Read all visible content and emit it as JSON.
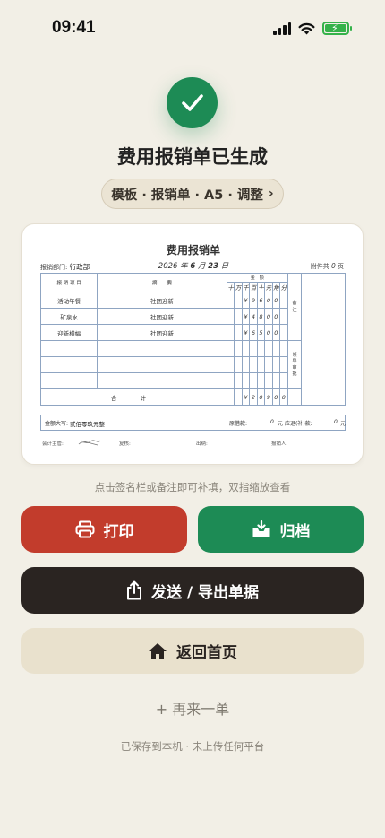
{
  "status_bar": {
    "time": "09:41"
  },
  "success": {
    "title": "费用报销单已生成"
  },
  "template_pill": {
    "label": "模板 · 报销单 · A5 · 调整",
    "chevron": "›"
  },
  "document": {
    "title": "费用报销单",
    "department_label": "报销部门:",
    "department": "行政部",
    "date_year": "2026",
    "date_month": "6",
    "date_day": "23",
    "attachments_label": "附件共",
    "attachments_count": "0",
    "attachments_unit": "页",
    "header": {
      "item": "报 销 项 目",
      "summary": "摘　　要",
      "amount": "金　额",
      "note": "备\n注",
      "units": [
        "十",
        "万",
        "千",
        "百",
        "十",
        "元",
        "角",
        "分"
      ]
    },
    "rows": [
      {
        "item": "活动午餐",
        "summary": "社团迎新",
        "digits": [
          "",
          "",
          "¥",
          "9",
          "6",
          "0",
          "0",
          ""
        ]
      },
      {
        "item": "矿泉水",
        "summary": "社团迎新",
        "digits": [
          "",
          "",
          "¥",
          "4",
          "8",
          "0",
          "0",
          ""
        ]
      },
      {
        "item": "迎新横幅",
        "summary": "社团迎新",
        "digits": [
          "",
          "",
          "¥",
          "6",
          "5",
          "0",
          "0",
          ""
        ]
      }
    ],
    "approve_label": "领\n导\n审\n批",
    "total_label": "合 计",
    "total_digits": [
      "",
      "",
      "¥",
      "2",
      "0",
      "9",
      "0",
      "0"
    ],
    "amount_in_words_label": "金额大写:",
    "amount_in_words": "贰佰零玖元整",
    "original_loan_label": "原借款:",
    "original_loan_value": "0",
    "original_loan_unit": "元",
    "refund_label": "应退(补)款:",
    "refund_value": "0",
    "refund_unit": "元",
    "signatures": {
      "supervisor": "会计主管:",
      "review": "复核:",
      "cashier": "出纳:",
      "claimant": "报销人:"
    }
  },
  "hint": "点击签名栏或备注即可补填，双指缩放查看",
  "buttons": {
    "print": "打印",
    "archive": "归档",
    "send": "发送 / 导出单据",
    "home": "返回首页"
  },
  "again": "+ 再来一单",
  "saved_note": "已保存到本机 · 未上传任何平台",
  "icons": {
    "check": "check-icon",
    "print": "printer-icon",
    "archive": "archive-tray-icon",
    "share": "share-icon",
    "home": "home-icon"
  },
  "colors": {
    "background": "#f2efe6",
    "success_green": "#1d8b55",
    "print_red": "#c23c2c",
    "dark": "#2a2421",
    "home_beige": "#e9e1cd"
  }
}
